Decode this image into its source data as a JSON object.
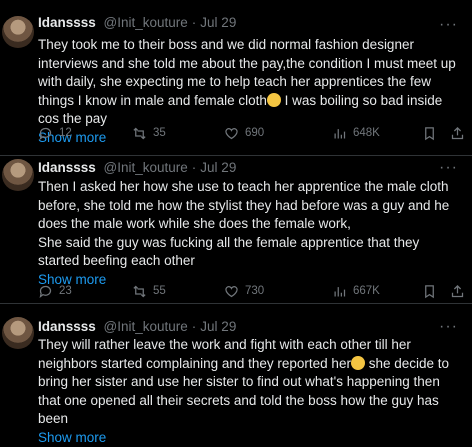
{
  "tweets": [
    {
      "name": "Idanssss ",
      "handle": "@Init_kouture",
      "date": "Jul 29",
      "text": "They took me to their boss and we did normal fashion designer interviews and she told me about the pay,the condition I must meet up with daily, she expecting me to help teach her apprentices the few things I know in male and female cloth",
      "text_after": " I was boiling so bad inside cos the pay",
      "emoji": "cat-with-tears-of-joy",
      "show_more": "Show more",
      "replies": "12",
      "reposts": "35",
      "likes": "690",
      "views": "648K"
    },
    {
      "name": "Idanssss ",
      "handle": "@Init_kouture",
      "date": "Jul 29",
      "text": "Then I asked her how she use to teach her apprentice the male cloth before, she told me how the stylist they had before was a guy and he does the male work while she does the female work,\nShe said the guy was fucking all the female apprentice that they started beefing each other",
      "text_after": "",
      "show_more": "Show more",
      "replies": "23",
      "reposts": "55",
      "likes": "730",
      "views": "667K"
    },
    {
      "name": "Idanssss ",
      "handle": "@Init_kouture",
      "date": "Jul 29",
      "text": "They will rather leave the work and fight with each other till her neighbors started complaining and they reported her",
      "text_after": " she decide to bring her sister and use her sister to find out what's happening then that one opened all their secrets and told the boss how the guy has been",
      "emoji": "sad-face",
      "show_more": "Show more"
    }
  ]
}
